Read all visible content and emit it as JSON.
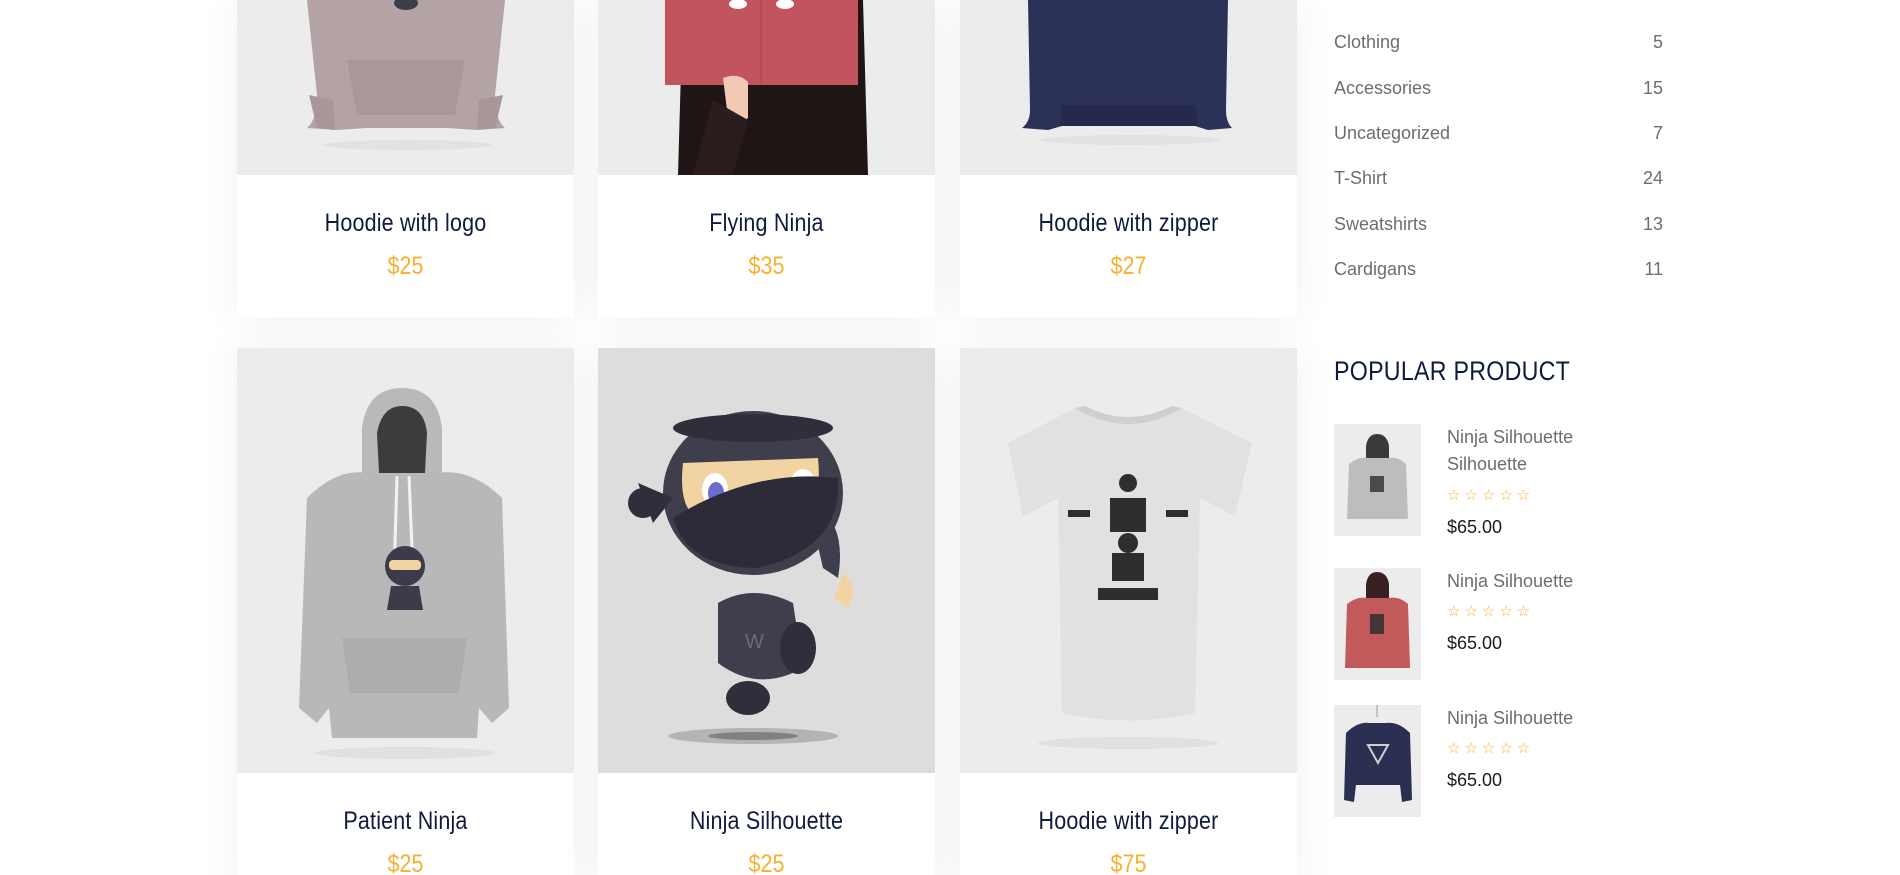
{
  "products": [
    {
      "name": "Hoodie with logo",
      "price": "$25",
      "image": "hoodie-logo-image"
    },
    {
      "name": "Flying Ninja",
      "price": "$35",
      "image": "flying-ninja-poster-image"
    },
    {
      "name": "Hoodie with zipper",
      "price": "$27",
      "image": "navy-hoodie-image"
    },
    {
      "name": "Patient Ninja",
      "price": "$25",
      "image": "grey-ninja-hoodie-image"
    },
    {
      "name": "Ninja Silhouette",
      "price": "$25",
      "image": "ninja-mascot-image"
    },
    {
      "name": "Hoodie with zipper",
      "price": "$75",
      "image": "ninja-tshirt-image"
    }
  ],
  "sidebar": {
    "categories": [
      {
        "label": "Clothing",
        "count": "5"
      },
      {
        "label": "Accessories",
        "count": "15"
      },
      {
        "label": "Uncategorized",
        "count": "7"
      },
      {
        "label": "T-Shirt",
        "count": "24"
      },
      {
        "label": "Sweatshirts",
        "count": "13"
      },
      {
        "label": "Cardigans",
        "count": "11"
      }
    ],
    "popular_heading": "POPULAR PRODUCT",
    "popular": [
      {
        "name": "Ninja Silhouette Silhouette",
        "stars": "☆☆☆☆☆",
        "price": "$65.00",
        "image": "grey-hoodie-thumb"
      },
      {
        "name": "Ninja Silhouette",
        "stars": "☆☆☆☆☆",
        "price": "$65.00",
        "image": "red-hoodie-thumb"
      },
      {
        "name": "Ninja Silhouette",
        "stars": "☆☆☆☆☆",
        "price": "$65.00",
        "image": "navy-sweatshirt-thumb"
      }
    ]
  },
  "colors": {
    "title": "#0e1b3d",
    "price": "#f7b030",
    "muted_text": "#6d6d6d",
    "image_bg": "#ececec"
  }
}
